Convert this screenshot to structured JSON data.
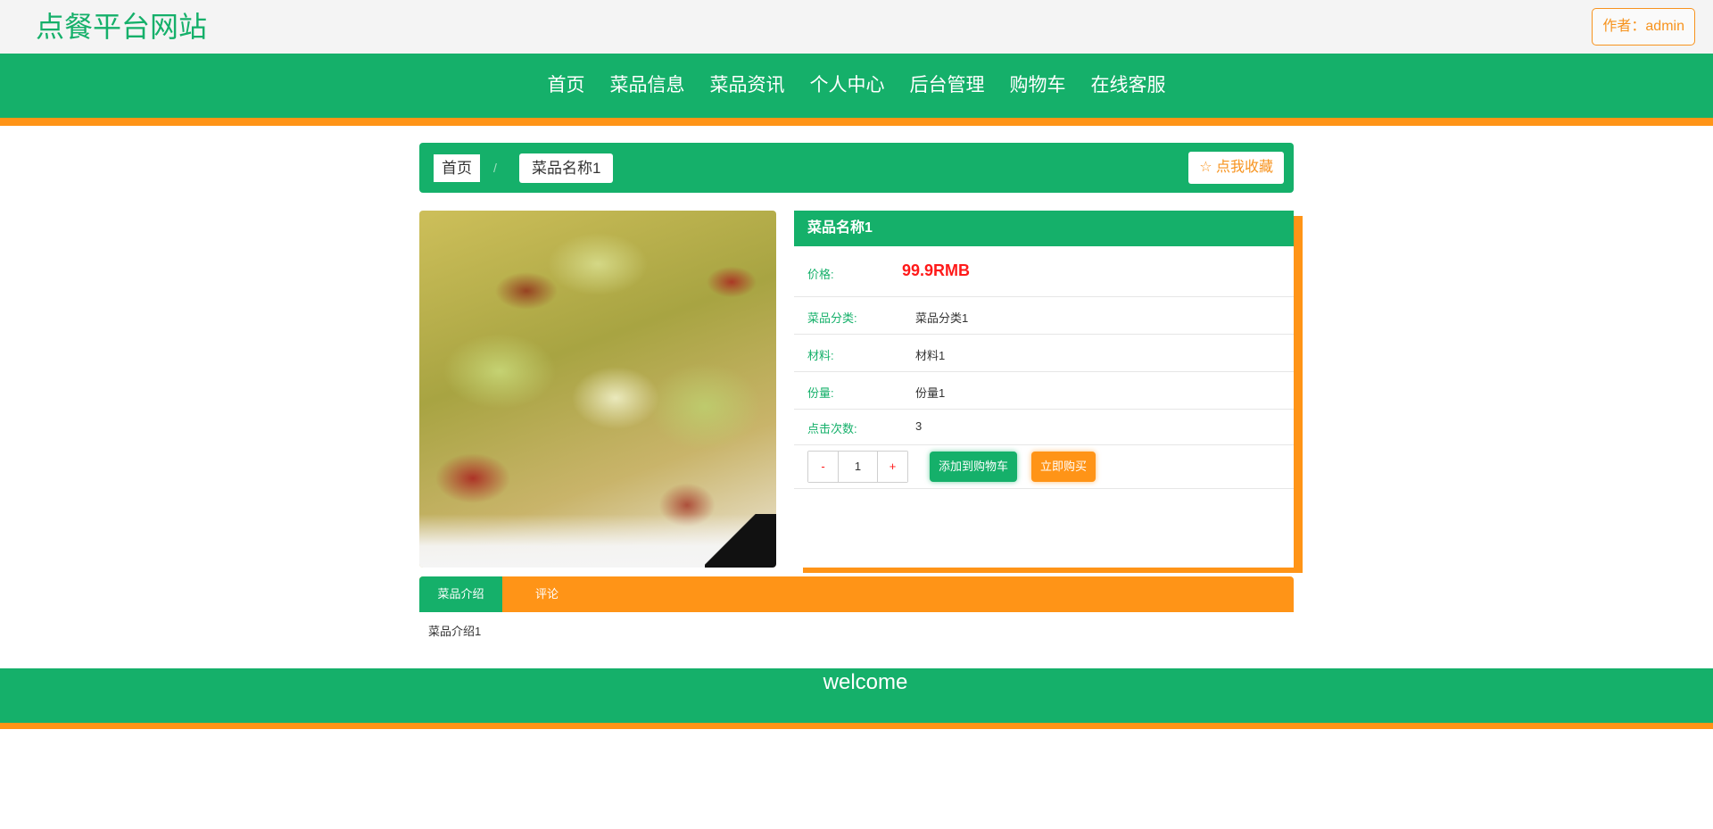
{
  "header": {
    "site_title": "点餐平台网站",
    "author_label": "作者：admin"
  },
  "nav": {
    "items": [
      "首页",
      "菜品信息",
      "菜品资讯",
      "个人中心",
      "后台管理",
      "购物车",
      "在线客服"
    ]
  },
  "breadcrumb": {
    "home": "首页",
    "separator": "/",
    "current": "菜品名称1",
    "favorite_label": "☆ 点我收藏"
  },
  "product": {
    "name": "菜品名称1",
    "price_label": "价格:",
    "price": "99.9RMB",
    "category_label": "菜品分类:",
    "category": "菜品分类1",
    "material_label": "材料:",
    "material": "材料1",
    "portion_label": "份量:",
    "portion": "份量1",
    "clicks_label": "点击次数:",
    "clicks": "3",
    "quantity": "1",
    "minus_label": "-",
    "plus_label": "+",
    "add_to_cart_label": "添加到购物车",
    "buy_now_label": "立即购买"
  },
  "tabs": {
    "intro_label": "菜品介绍",
    "comment_label": "评论"
  },
  "intro": {
    "text": "菜品介绍1"
  },
  "footer": {
    "text": "welcome"
  },
  "colors": {
    "primary": "#15b06a",
    "accent": "#ff9417",
    "price": "#ff1a1a",
    "topbar_bg": "#f4f4f4"
  }
}
